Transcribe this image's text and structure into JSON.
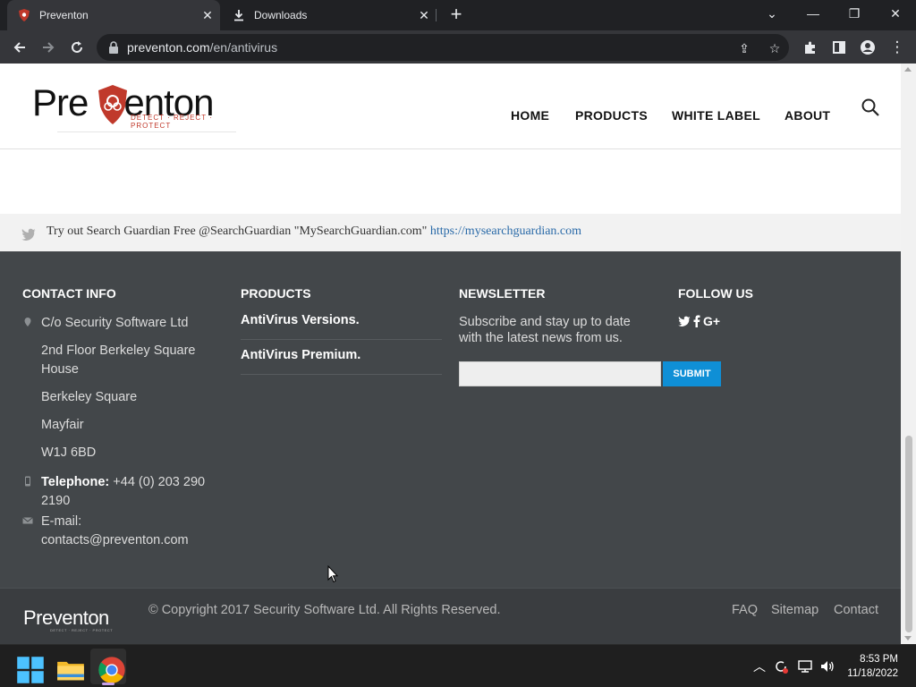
{
  "browser": {
    "tabs": [
      {
        "title": "Preventon",
        "active": true
      },
      {
        "title": "Downloads",
        "active": false
      }
    ],
    "url_host": "preventon.com",
    "url_path": "/en/antivirus"
  },
  "header": {
    "logo_left": "Pre",
    "logo_right": "enton",
    "logo_tagline": "DETECT · REJECT · PROTECT",
    "nav": [
      "HOME",
      "PRODUCTS",
      "WHITE LABEL",
      "ABOUT"
    ]
  },
  "tweet": {
    "text": "Try out Search Guardian Free @SearchGuardian \"MySearchGuardian.com\" ",
    "link": "https://mysearchguardian.com"
  },
  "footer": {
    "contact_title": "CONTACT INFO",
    "address": [
      "C/o Security Software Ltd",
      "2nd Floor Berkeley Square House",
      "Berkeley Square",
      "Mayfair",
      "W1J 6BD"
    ],
    "telephone_label": "Telephone:",
    "telephone_value": "+44 (0) 203 290 2190",
    "email_label": "E-mail:",
    "email_value": "contacts@preventon.com",
    "products_title": "PRODUCTS",
    "products": [
      "AntiVirus Versions.",
      "AntiVirus Premium."
    ],
    "newsletter_title": "NEWSLETTER",
    "newsletter_text": "Subscribe and stay up to date with the latest news from us.",
    "newsletter_placeholder": "",
    "submit_label": "SUBMIT",
    "follow_title": "FOLLOW US",
    "social": [
      "twitter-icon",
      "facebook-icon",
      "google-plus-icon"
    ]
  },
  "bottom": {
    "logo": "Preventon",
    "logo_tagline": "DETECT · REJECT · PROTECT",
    "copyright": "© Copyright 2017 Security Software Ltd. All Rights Reserved.",
    "links": [
      "FAQ",
      "Sitemap",
      "Contact"
    ]
  },
  "taskbar": {
    "time": "8:53 PM",
    "date": "11/18/2022"
  },
  "colors": {
    "footer_bg": "#43474a",
    "submit_bg": "#0f8fd6",
    "brand_red": "#c0392b"
  }
}
